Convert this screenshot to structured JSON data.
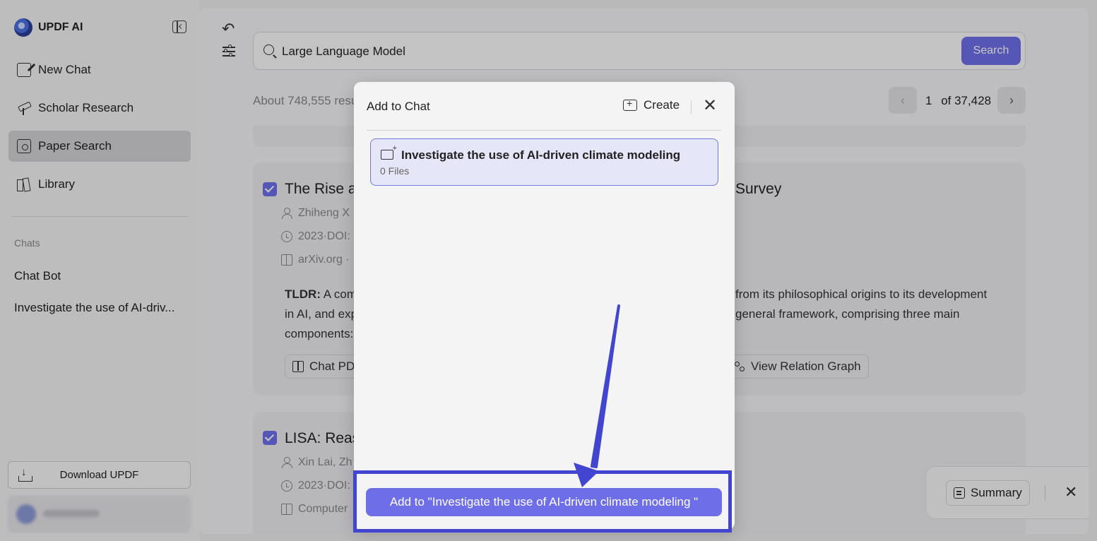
{
  "sidebar": {
    "brand": "UPDF AI",
    "nav": [
      {
        "label": "New Chat",
        "icon": "edit-icon"
      },
      {
        "label": "Scholar Research",
        "icon": "telescope-icon"
      },
      {
        "label": "Paper Search",
        "icon": "paper-search-icon",
        "active": true
      },
      {
        "label": "Library",
        "icon": "library-icon"
      }
    ],
    "chats_heading": "Chats",
    "chats": [
      "Chat Bot",
      "Investigate the use of AI-driv..."
    ],
    "download_label": "Download UPDF"
  },
  "search": {
    "value": "Large Language Model",
    "button": "Search"
  },
  "results": {
    "summary": "About 748,555 resu",
    "page_current": "1",
    "page_total": "of 37,428"
  },
  "cards": [
    {
      "title_visible": "The Rise a",
      "title_tail": "Survey",
      "author": "Zhiheng X",
      "date": "2023·DOI:",
      "venue": "arXiv.org ·",
      "tldr_label": "TLDR:",
      "tldr_line1": " A com",
      "tldr_line2": "in AI, and exp",
      "tldr_line3": "components:",
      "tldr_right1": "from its philosophical origins to its development",
      "tldr_right2": "general framework, comprising three main",
      "chat_pdf": "Chat PD",
      "relation_graph": "View Relation Graph"
    },
    {
      "title_visible": "LISA: Reas",
      "author": "Xin Lai,  Zh",
      "date": "2023·DOI:",
      "venue": "Computer"
    }
  ],
  "action_bar": {
    "summary": "Summary"
  },
  "modal": {
    "title": "Add to Chat",
    "create": "Create",
    "folder_name": "Investigate the use of AI-driven climate modeling",
    "folder_files": "0 Files",
    "add_button": "Add to \"Investigate the use of AI-driven climate modeling \""
  },
  "colors": {
    "accent": "#6e6fe8",
    "annotation": "#4245d0"
  }
}
